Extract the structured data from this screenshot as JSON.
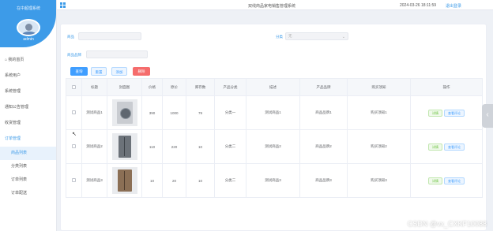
{
  "app": {
    "brand": "在中超理系统",
    "user": "admin",
    "system_title": "双线商品家电销售管理系统",
    "datetime": "2024-03-26 18:11:59",
    "logout": "退出登录"
  },
  "menu": [
    {
      "label": "我的首页"
    },
    {
      "label": "系统用户"
    },
    {
      "label": "系统管理"
    },
    {
      "label": "通知公告管理"
    },
    {
      "label": "收货管理"
    },
    {
      "label": "订单管理"
    }
  ],
  "submenu": [
    {
      "label": "商品列表"
    },
    {
      "label": "分类列表"
    },
    {
      "label": "订单列表"
    },
    {
      "label": "订单配送"
    }
  ],
  "search": {
    "name_label": "商品",
    "name_value": "",
    "type_label": "分类",
    "type_value": "无",
    "brand_label": "商品品牌",
    "brand_value": ""
  },
  "buttons": {
    "search": "查询",
    "reset": "重置",
    "add": "添加",
    "delete": "删除"
  },
  "table": {
    "headers": [
      "",
      "标题",
      "封面图",
      "价格",
      "原价",
      "库存数",
      "产品分类",
      "描述",
      "产品品牌",
      "购买须知",
      "操作"
    ],
    "rows": [
      {
        "title": "测试商品1",
        "price": "390",
        "orig": "1000",
        "stock": "79",
        "category": "分类一",
        "desc": "测试商品1",
        "brand": "商品品牌1",
        "notice": "购买须知1",
        "image": "washer"
      },
      {
        "title": "测试商品2",
        "price": "110",
        "orig": "220",
        "stock": "10",
        "category": "分类二",
        "desc": "测试商品2",
        "brand": "商品品牌2",
        "notice": "购买须知2",
        "image": "fridge1"
      },
      {
        "title": "测试商品3",
        "price": "10",
        "orig": "20",
        "stock": "10",
        "category": "分类二",
        "desc": "测试商品3",
        "brand": "商品品牌3",
        "notice": "购买须知3",
        "image": "fridge2"
      }
    ],
    "op_edit": "详情",
    "op_view": "查看评论"
  },
  "watermark": "CSDN @vx_CXKF10088",
  "colors": {
    "primary": "#3d9be8",
    "danger": "#f56c6c",
    "success": "#67c23a"
  }
}
